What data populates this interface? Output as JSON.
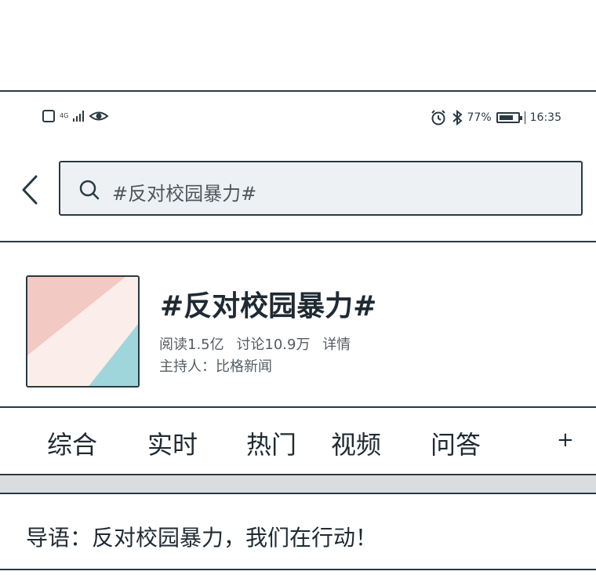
{
  "status_bar": {
    "network": "4G",
    "battery_text": "77%",
    "battery_level": 0.77,
    "time": "16:35"
  },
  "search": {
    "query": "#反对校园暴力#"
  },
  "topic": {
    "title": "#反对校园暴力#",
    "reads": "阅读1.5亿",
    "discussions": "讨论10.9万",
    "details_link": "详情",
    "host": "主持人：比格新闻"
  },
  "tabs": [
    "综合",
    "实时",
    "热门",
    "视频",
    "问答"
  ],
  "tab_more": "+",
  "intro": {
    "text": "导语：反对校园暴力，我们在行动！"
  },
  "colors": {
    "outline": "#2a3a44",
    "cover_pink": "#f2c9c3",
    "cover_cream": "#fbeeea",
    "cover_cyan": "#9fd6dc"
  }
}
